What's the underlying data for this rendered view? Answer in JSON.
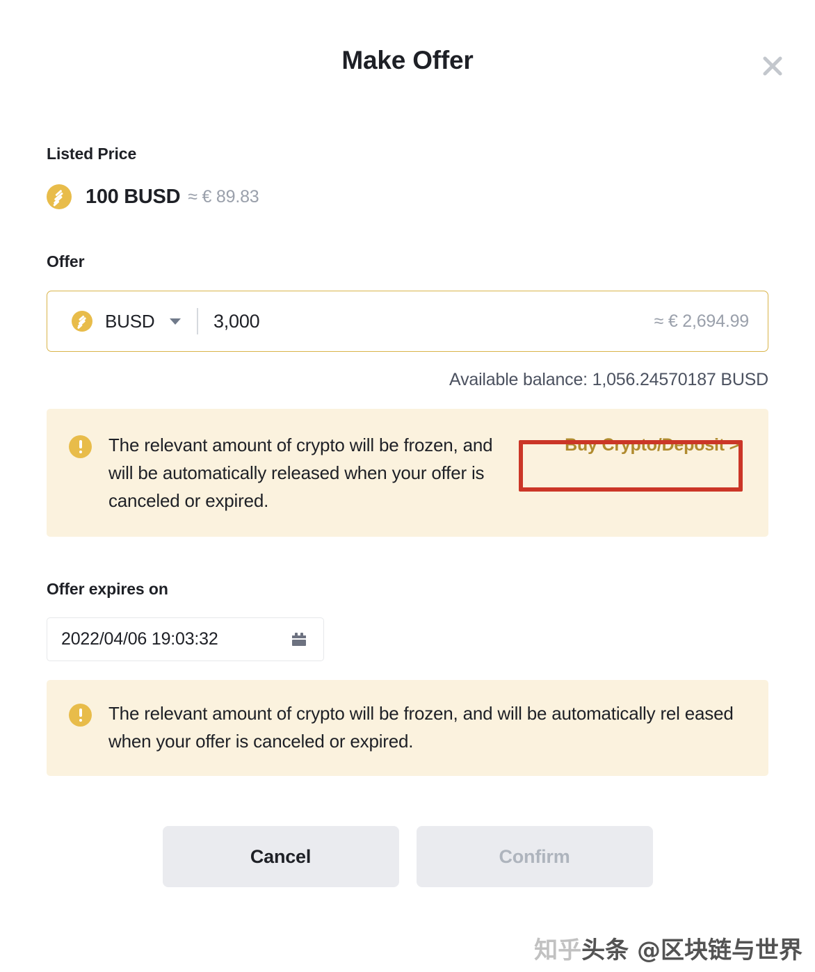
{
  "modal": {
    "title": "Make Offer",
    "close_icon": "close-icon"
  },
  "listed_price": {
    "label": "Listed Price",
    "coin_icon": "busd-coin-icon",
    "amount": "100 BUSD",
    "approx": "≈ € 89.83"
  },
  "offer": {
    "label": "Offer",
    "currency": "BUSD",
    "currency_icon": "busd-coin-icon",
    "dropdown_icon": "chevron-down-icon",
    "amount": "3,000",
    "approx": "≈ € 2,694.99",
    "balance": "Available balance: 1,056.24570187 BUSD"
  },
  "alert_primary": {
    "warn_icon": "warning-icon",
    "text": "The relevant amount of crypto will be frozen, and will be automatically released when your offer is canceled or expired.",
    "link_label": "Buy Crypto/Deposit >"
  },
  "expiry": {
    "label": "Offer expires on",
    "value": "2022/04/06 19:03:32",
    "calendar_icon": "calendar-icon"
  },
  "alert_secondary": {
    "warn_icon": "warning-icon",
    "text": "The relevant amount of crypto will be frozen, and will be automatically rel eased when your offer is canceled or expired."
  },
  "footer": {
    "cancel_label": "Cancel",
    "confirm_label": "Confirm"
  },
  "watermark": {
    "faded_prefix": "知乎",
    "text": "头条 @区块链与世界"
  },
  "colors": {
    "accent_gold": "#e8bc4a",
    "border_gold": "#d9b44a",
    "alert_bg": "#fbf2de",
    "link_gold": "#b08b2e",
    "annotation_red": "#cb3627",
    "button_bg": "#eaebef",
    "text_primary": "#1e2026",
    "text_muted": "#9aa0ab"
  }
}
